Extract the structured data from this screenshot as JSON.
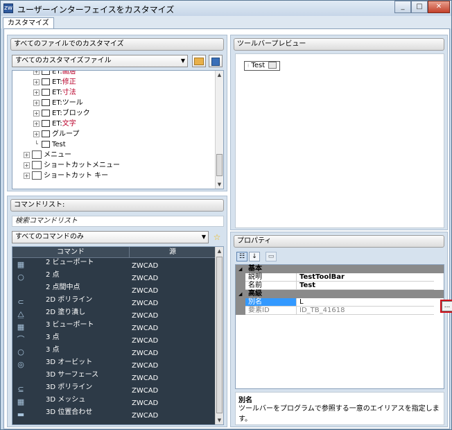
{
  "window": {
    "title": "ユーザーインターフェイスをカスタマイズ",
    "app_icon": "zw",
    "btn_min": "_",
    "btn_max": "□",
    "btn_close": "✕"
  },
  "tabs": {
    "active": "カスタマイズ"
  },
  "files_panel": {
    "header": "すべてのファイルでのカスタマイズ",
    "combo_value": "すべてのカスタマイズファイル",
    "open_icon": "folder-icon",
    "save_icon": "save-icon",
    "tree": [
      {
        "label": "ET:画層",
        "red": "画層",
        "prefix": "ET:"
      },
      {
        "label": "ET:修正",
        "red": "修正",
        "prefix": "ET:"
      },
      {
        "label": "ET:寸法",
        "red": "寸法",
        "prefix": "ET:"
      },
      {
        "label": "ET:ツール"
      },
      {
        "label": "ET:ブロック"
      },
      {
        "label": "ET:文字",
        "red": "文字",
        "prefix": "ET:"
      },
      {
        "label": "グループ"
      },
      {
        "label": "Test"
      }
    ],
    "tree_root": [
      {
        "label": "メニュー"
      },
      {
        "label": "ショートカットメニュー"
      },
      {
        "label": "ショートカット キー"
      }
    ]
  },
  "cmdlist_panel": {
    "header": "コマンドリスト:",
    "search_placeholder": "検索コマンドリスト",
    "combo_value": "すべてのコマンドのみ",
    "star_icon": "favorite-star-icon",
    "columns": [
      "コマンド",
      "源"
    ],
    "rows": [
      {
        "icon": "▦",
        "name": "2 ビューポート",
        "src": "ZWCAD"
      },
      {
        "icon": "○",
        "name": "2 点",
        "src": "ZWCAD"
      },
      {
        "icon": "",
        "name": "2 点間中点",
        "src": "ZWCAD"
      },
      {
        "icon": "⊂",
        "name": "2D ポリライン",
        "src": "ZWCAD"
      },
      {
        "icon": "⧋",
        "name": "2D 塗り潰し",
        "src": "ZWCAD"
      },
      {
        "icon": "▦",
        "name": "3 ビューポート",
        "src": "ZWCAD"
      },
      {
        "icon": "⌒",
        "name": "3 点",
        "src": "ZWCAD"
      },
      {
        "icon": "○",
        "name": "3 点",
        "src": "ZWCAD"
      },
      {
        "icon": "◎",
        "name": "3D オービット",
        "src": "ZWCAD"
      },
      {
        "icon": "",
        "name": "3D サーフェース",
        "src": "ZWCAD"
      },
      {
        "icon": "⊆",
        "name": "3D ポリライン",
        "src": "ZWCAD"
      },
      {
        "icon": "▦",
        "name": "3D メッシュ",
        "src": "ZWCAD"
      },
      {
        "icon": "▬",
        "name": "3D 位置合わせ",
        "src": "ZWCAD"
      }
    ]
  },
  "preview_panel": {
    "header": "ツールバープレビュー",
    "toolbar_name": "Test",
    "toolbar_icon": "toolbar-preview-icon"
  },
  "props_panel": {
    "header": "プロパティ",
    "categories": [
      {
        "name": "基本",
        "rows": [
          {
            "key": "説明",
            "value": "TestToolBar"
          },
          {
            "key": "名前",
            "value": "Test"
          }
        ]
      },
      {
        "name": "高級",
        "rows": [
          {
            "key": "別名",
            "value": "L"
          },
          {
            "key": "要素ID",
            "value": "ID_TB_41618"
          }
        ]
      }
    ],
    "ellipsis_label": "...",
    "desc_title": "別名",
    "desc_text": "ツールバーをプログラムで参照する一意のエイリアスを指定します。"
  },
  "colors": {
    "highlight_red": "#d0101a",
    "selected_blue": "#3399ff"
  }
}
